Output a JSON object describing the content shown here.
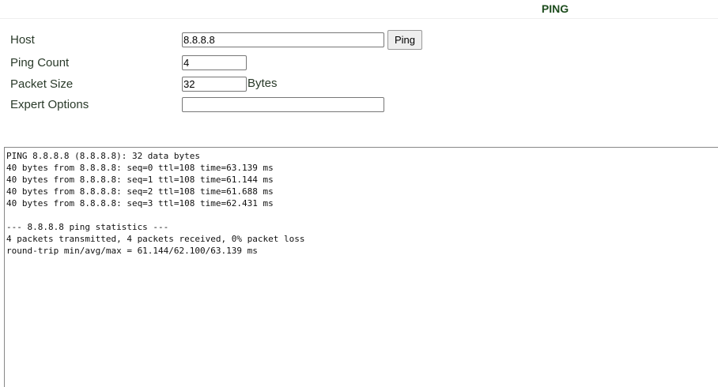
{
  "header": {
    "title": "PING"
  },
  "form": {
    "host_label": "Host",
    "host_value": "8.8.8.8",
    "ping_button": "Ping",
    "count_label": "Ping Count",
    "count_value": "4",
    "size_label": "Packet Size",
    "size_value": "32",
    "size_unit": "Bytes",
    "expert_label": "Expert Options",
    "expert_value": ""
  },
  "output": {
    "text": "PING 8.8.8.8 (8.8.8.8): 32 data bytes\n40 bytes from 8.8.8.8: seq=0 ttl=108 time=63.139 ms\n40 bytes from 8.8.8.8: seq=1 ttl=108 time=61.144 ms\n40 bytes from 8.8.8.8: seq=2 ttl=108 time=61.688 ms\n40 bytes from 8.8.8.8: seq=3 ttl=108 time=62.431 ms\n\n--- 8.8.8.8 ping statistics ---\n4 packets transmitted, 4 packets received, 0% packet loss\nround-trip min/avg/max = 61.144/62.100/63.139 ms"
  }
}
